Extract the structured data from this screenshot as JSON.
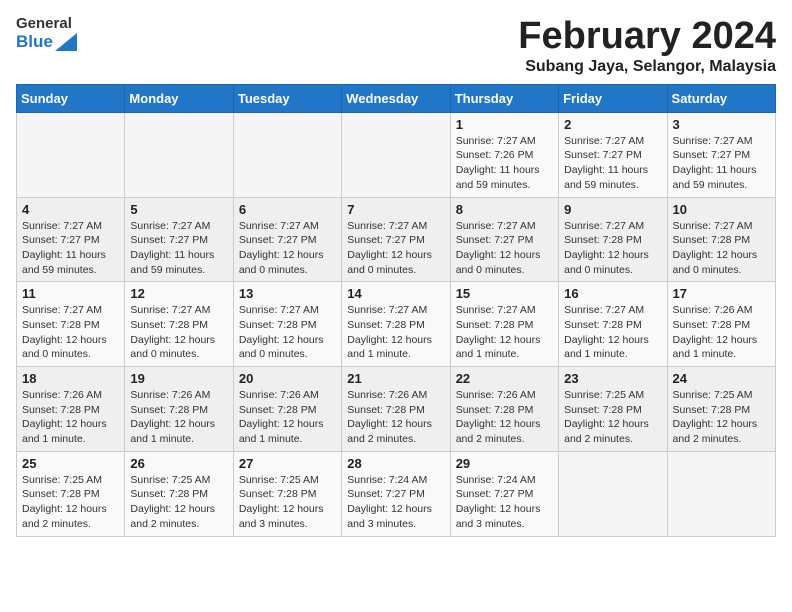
{
  "header": {
    "logo_general": "General",
    "logo_blue": "Blue",
    "month_title": "February 2024",
    "subtitle": "Subang Jaya, Selangor, Malaysia"
  },
  "days_of_week": [
    "Sunday",
    "Monday",
    "Tuesday",
    "Wednesday",
    "Thursday",
    "Friday",
    "Saturday"
  ],
  "weeks": [
    [
      {
        "day": "",
        "info": ""
      },
      {
        "day": "",
        "info": ""
      },
      {
        "day": "",
        "info": ""
      },
      {
        "day": "",
        "info": ""
      },
      {
        "day": "1",
        "info": "Sunrise: 7:27 AM\nSunset: 7:26 PM\nDaylight: 11 hours and 59 minutes."
      },
      {
        "day": "2",
        "info": "Sunrise: 7:27 AM\nSunset: 7:27 PM\nDaylight: 11 hours and 59 minutes."
      },
      {
        "day": "3",
        "info": "Sunrise: 7:27 AM\nSunset: 7:27 PM\nDaylight: 11 hours and 59 minutes."
      }
    ],
    [
      {
        "day": "4",
        "info": "Sunrise: 7:27 AM\nSunset: 7:27 PM\nDaylight: 11 hours and 59 minutes."
      },
      {
        "day": "5",
        "info": "Sunrise: 7:27 AM\nSunset: 7:27 PM\nDaylight: 11 hours and 59 minutes."
      },
      {
        "day": "6",
        "info": "Sunrise: 7:27 AM\nSunset: 7:27 PM\nDaylight: 12 hours and 0 minutes."
      },
      {
        "day": "7",
        "info": "Sunrise: 7:27 AM\nSunset: 7:27 PM\nDaylight: 12 hours and 0 minutes."
      },
      {
        "day": "8",
        "info": "Sunrise: 7:27 AM\nSunset: 7:27 PM\nDaylight: 12 hours and 0 minutes."
      },
      {
        "day": "9",
        "info": "Sunrise: 7:27 AM\nSunset: 7:28 PM\nDaylight: 12 hours and 0 minutes."
      },
      {
        "day": "10",
        "info": "Sunrise: 7:27 AM\nSunset: 7:28 PM\nDaylight: 12 hours and 0 minutes."
      }
    ],
    [
      {
        "day": "11",
        "info": "Sunrise: 7:27 AM\nSunset: 7:28 PM\nDaylight: 12 hours and 0 minutes."
      },
      {
        "day": "12",
        "info": "Sunrise: 7:27 AM\nSunset: 7:28 PM\nDaylight: 12 hours and 0 minutes."
      },
      {
        "day": "13",
        "info": "Sunrise: 7:27 AM\nSunset: 7:28 PM\nDaylight: 12 hours and 0 minutes."
      },
      {
        "day": "14",
        "info": "Sunrise: 7:27 AM\nSunset: 7:28 PM\nDaylight: 12 hours and 1 minute."
      },
      {
        "day": "15",
        "info": "Sunrise: 7:27 AM\nSunset: 7:28 PM\nDaylight: 12 hours and 1 minute."
      },
      {
        "day": "16",
        "info": "Sunrise: 7:27 AM\nSunset: 7:28 PM\nDaylight: 12 hours and 1 minute."
      },
      {
        "day": "17",
        "info": "Sunrise: 7:26 AM\nSunset: 7:28 PM\nDaylight: 12 hours and 1 minute."
      }
    ],
    [
      {
        "day": "18",
        "info": "Sunrise: 7:26 AM\nSunset: 7:28 PM\nDaylight: 12 hours and 1 minute."
      },
      {
        "day": "19",
        "info": "Sunrise: 7:26 AM\nSunset: 7:28 PM\nDaylight: 12 hours and 1 minute."
      },
      {
        "day": "20",
        "info": "Sunrise: 7:26 AM\nSunset: 7:28 PM\nDaylight: 12 hours and 1 minute."
      },
      {
        "day": "21",
        "info": "Sunrise: 7:26 AM\nSunset: 7:28 PM\nDaylight: 12 hours and 2 minutes."
      },
      {
        "day": "22",
        "info": "Sunrise: 7:26 AM\nSunset: 7:28 PM\nDaylight: 12 hours and 2 minutes."
      },
      {
        "day": "23",
        "info": "Sunrise: 7:25 AM\nSunset: 7:28 PM\nDaylight: 12 hours and 2 minutes."
      },
      {
        "day": "24",
        "info": "Sunrise: 7:25 AM\nSunset: 7:28 PM\nDaylight: 12 hours and 2 minutes."
      }
    ],
    [
      {
        "day": "25",
        "info": "Sunrise: 7:25 AM\nSunset: 7:28 PM\nDaylight: 12 hours and 2 minutes."
      },
      {
        "day": "26",
        "info": "Sunrise: 7:25 AM\nSunset: 7:28 PM\nDaylight: 12 hours and 2 minutes."
      },
      {
        "day": "27",
        "info": "Sunrise: 7:25 AM\nSunset: 7:28 PM\nDaylight: 12 hours and 3 minutes."
      },
      {
        "day": "28",
        "info": "Sunrise: 7:24 AM\nSunset: 7:27 PM\nDaylight: 12 hours and 3 minutes."
      },
      {
        "day": "29",
        "info": "Sunrise: 7:24 AM\nSunset: 7:27 PM\nDaylight: 12 hours and 3 minutes."
      },
      {
        "day": "",
        "info": ""
      },
      {
        "day": "",
        "info": ""
      }
    ]
  ]
}
